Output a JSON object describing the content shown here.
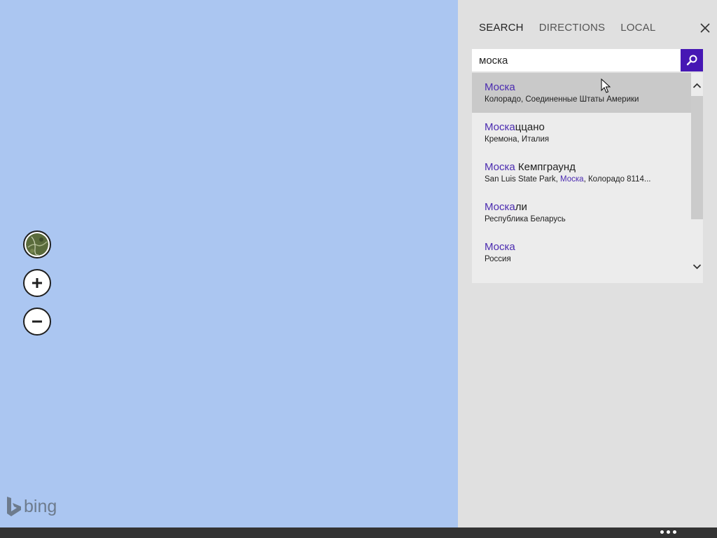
{
  "tabs": [
    {
      "label": "SEARCH",
      "active": true
    },
    {
      "label": "DIRECTIONS",
      "active": false
    },
    {
      "label": "LOCAL",
      "active": false
    }
  ],
  "search": {
    "value": "моска"
  },
  "suggestions": [
    {
      "title_hl": "Моска",
      "title_rest": "",
      "sub_pre": "Колорадо, Соединенные Штаты Америки",
      "sub_hl": "",
      "sub_post": "",
      "selected": true
    },
    {
      "title_hl": "Моска",
      "title_rest": "ццано",
      "sub_pre": "Кремона, Италия",
      "sub_hl": "",
      "sub_post": "",
      "selected": false
    },
    {
      "title_hl": "Моска",
      "title_rest": " Кемпграунд",
      "sub_pre": "San Luis State Park, ",
      "sub_hl": "Моска",
      "sub_post": ", Колорадо 8114...",
      "selected": false
    },
    {
      "title_hl": "Моска",
      "title_rest": "ли",
      "sub_pre": "Республика Беларусь",
      "sub_hl": "",
      "sub_post": "",
      "selected": false
    },
    {
      "title_hl": "Моска",
      "title_rest": "",
      "sub_pre": "Россия",
      "sub_hl": "",
      "sub_post": "",
      "selected": false
    }
  ],
  "branding": {
    "logo_text": "bing"
  },
  "colors": {
    "accent": "#4617b4",
    "highlight": "#4b2bb0",
    "map_water": "#abc6f1",
    "panel_bg": "#e0e0e0"
  }
}
